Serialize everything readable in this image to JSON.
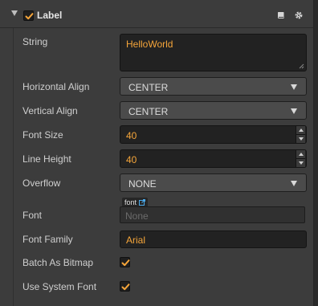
{
  "component": {
    "title": "Label",
    "enabled": true,
    "icons": {
      "docs": "book-icon",
      "settings": "gear-icon"
    }
  },
  "properties": {
    "string": {
      "label": "String",
      "value": "HelloWorld"
    },
    "horizontal_align": {
      "label": "Horizontal Align",
      "value": "CENTER"
    },
    "vertical_align": {
      "label": "Vertical Align",
      "value": "CENTER"
    },
    "font_size": {
      "label": "Font Size",
      "value": "40"
    },
    "line_height": {
      "label": "Line Height",
      "value": "40"
    },
    "overflow": {
      "label": "Overflow",
      "value": "NONE"
    },
    "font": {
      "label": "Font",
      "asset_type": "font",
      "value": "None"
    },
    "font_family": {
      "label": "Font Family",
      "value": "Arial"
    },
    "batch_as_bitmap": {
      "label": "Batch As Bitmap",
      "checked": true
    },
    "use_system_font": {
      "label": "Use System Font",
      "checked": true
    }
  },
  "colors": {
    "accent": "#f5a53a",
    "panel_bg": "#3c3c3c",
    "field_bg": "#222222"
  }
}
